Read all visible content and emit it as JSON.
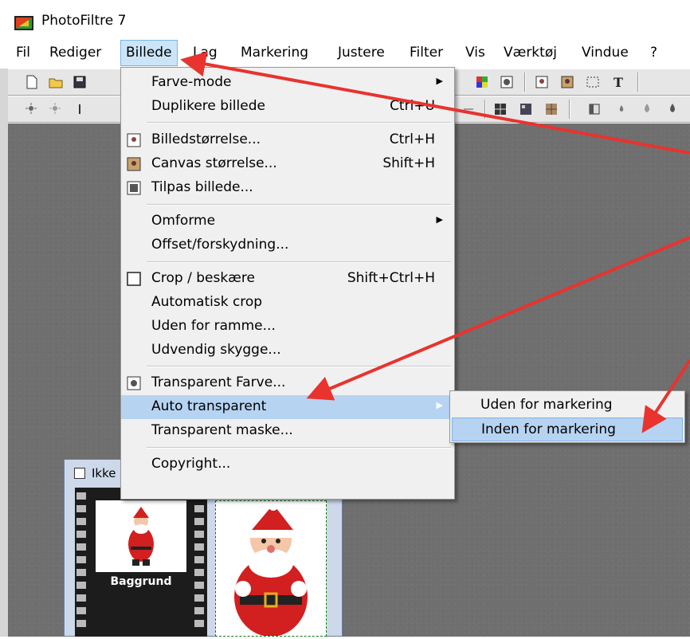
{
  "app": {
    "title": "PhotoFiltre 7"
  },
  "menubar": [
    "Fil",
    "Rediger",
    "Billede",
    "Lag",
    "Markering",
    "Justere",
    "Filter",
    "Vis",
    "Værktøj",
    "Vindue",
    "?"
  ],
  "billede_menu": [
    {
      "label": "Farve-mode",
      "shortcut": "",
      "submenu": true
    },
    {
      "label": "Duplikere billede",
      "shortcut": "Ctrl+U"
    },
    {
      "label": "Billedstørrelse...",
      "shortcut": "Ctrl+H",
      "icon": "image-size-icon"
    },
    {
      "label": "Canvas størrelse...",
      "shortcut": "Shift+H",
      "icon": "canvas-size-icon"
    },
    {
      "label": "Tilpas billede...",
      "shortcut": "",
      "icon": "fit-image-icon"
    },
    {
      "label": "Omforme",
      "shortcut": "",
      "submenu": true
    },
    {
      "label": "Offset/forskydning...",
      "shortcut": ""
    },
    {
      "label": "Crop / beskære",
      "shortcut": "Shift+Ctrl+H",
      "icon": "crop-icon"
    },
    {
      "label": "Automatisk crop",
      "shortcut": ""
    },
    {
      "label": "Uden for ramme...",
      "shortcut": ""
    },
    {
      "label": "Udvendig skygge...",
      "shortcut": ""
    },
    {
      "label": "Transparent Farve...",
      "shortcut": "",
      "icon": "transparent-color-icon"
    },
    {
      "label": "Auto transparent",
      "shortcut": "",
      "submenu": true
    },
    {
      "label": "Transparent maske...",
      "shortcut": ""
    },
    {
      "label": "Copyright...",
      "shortcut": ""
    }
  ],
  "auto_transparent_submenu": [
    "Uden for markering",
    "Inden for markering"
  ],
  "image_window": {
    "title": "Ikke navngivet ...",
    "layer_label": "Baggrund"
  },
  "colors": {
    "arrow": "#e8332f",
    "menu_highlight": "#b6d3f2"
  }
}
